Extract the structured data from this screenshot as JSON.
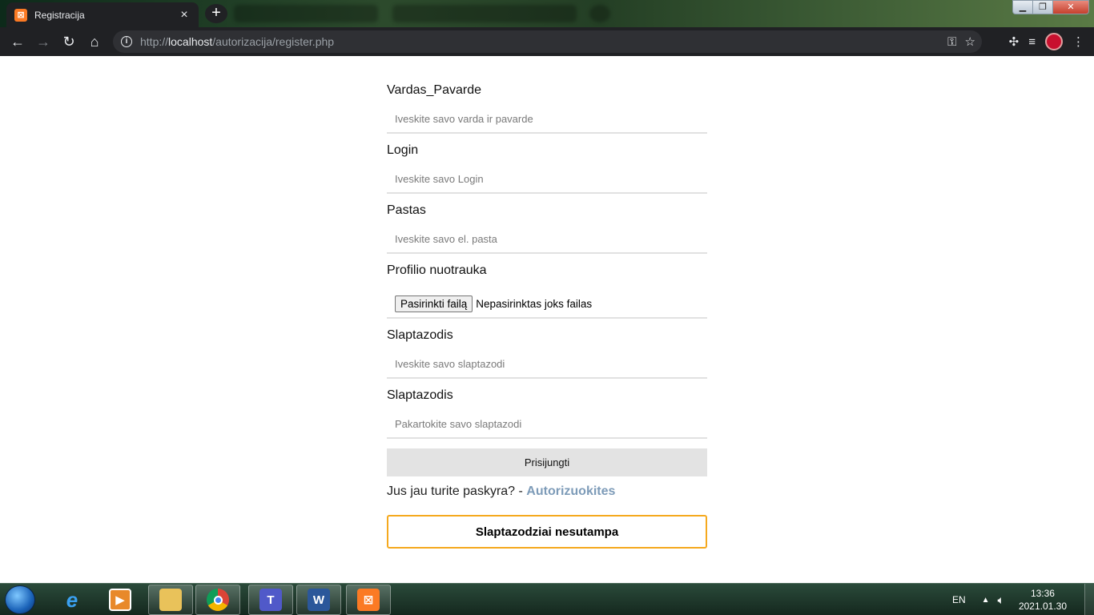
{
  "browser": {
    "tab_title": "Registracija",
    "tab_close": "×",
    "new_tab": "+",
    "url_prefix": "http://",
    "url_host": "localhost",
    "url_path": "/autorizacija/register.php"
  },
  "form": {
    "fields": [
      {
        "label": "Vardas_Pavarde",
        "placeholder": "Iveskite savo varda ir pavarde"
      },
      {
        "label": "Login",
        "placeholder": "Iveskite savo Login"
      },
      {
        "label": "Pastas",
        "placeholder": "Iveskite savo el. pasta"
      },
      {
        "label": "Slaptazodis",
        "placeholder": "Iveskite savo slaptazodi"
      },
      {
        "label": "Slaptazodis",
        "placeholder": "Pakartokite savo slaptazodi"
      }
    ],
    "photo_label": "Profilio nuotrauka",
    "file_button": "Pasirinkti failą",
    "file_status": "Nepasirinktas joks failas",
    "submit": "Prisijungti",
    "account_text": "Jus jau turite paskyra? - ",
    "account_link": "Autorizuokites",
    "error_message": "Slaptazodziai nesutampa"
  },
  "taskbar": {
    "language": "EN",
    "time": "13:36",
    "date": "2021.01.30"
  },
  "colors": {
    "accent_border": "#f5a91e",
    "link": "#7d9bb8"
  }
}
